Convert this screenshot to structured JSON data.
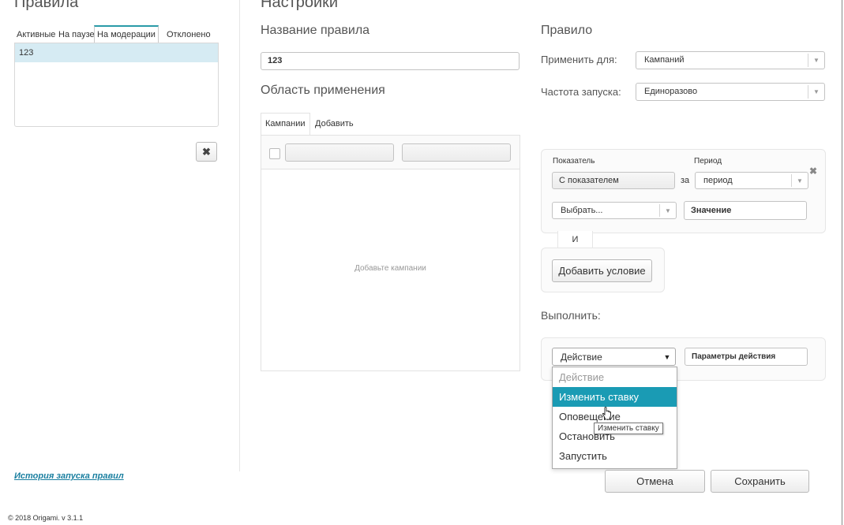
{
  "left": {
    "title": "Правила",
    "tabs": [
      "Активные",
      "На паузе",
      "На модерации",
      "Отклонено"
    ],
    "rules": [
      "123"
    ],
    "history_link": "История запуска правил",
    "footer": "© 2018 Origami. v 3.1.1"
  },
  "settings": {
    "title": "Настройки",
    "rule_name_label": "Название правила",
    "rule_name_value": "123",
    "scope_label": "Область применения",
    "scope_tabs": [
      "Кампании",
      "Добавить"
    ],
    "empty_campaigns": "Добавьте кампании"
  },
  "rule": {
    "title": "Правило",
    "apply_for_label": "Применить для:",
    "apply_for_value": "Кампаний",
    "frequency_label": "Частота запуска:",
    "frequency_value": "Единоразово",
    "condition": {
      "indicator_label": "Показатель",
      "period_label": "Период",
      "indicator_value": "С показателем",
      "for_label": "за",
      "period_value": "период",
      "choose_value": "Выбрать...",
      "value_placeholder": "Значение"
    },
    "and_label": "И",
    "add_condition": "Добавить условие",
    "execute_label": "Выполнить:",
    "action_value": "Действие",
    "action_params_placeholder": "Параметры действия",
    "action_options": [
      "Действие",
      "Изменить ставку",
      "Оповещение",
      "Остановить",
      "Запустить"
    ],
    "tooltip": "Изменить ставку",
    "cancel": "Отмена",
    "save": "Сохранить"
  },
  "colors": {
    "accent": "#1a9bb4",
    "link": "#1a7fa0"
  }
}
